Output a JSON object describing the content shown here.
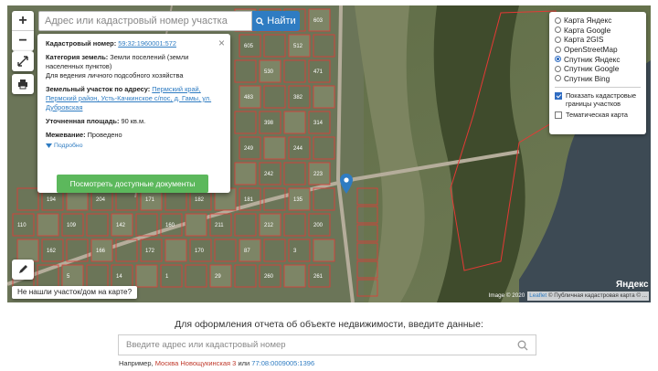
{
  "map": {
    "search_placeholder": "Адрес или кадастровый номер участка",
    "search_button": "Найти",
    "zoom_in": "+",
    "zoom_out": "−",
    "not_found_link": "Не нашли участок/дом на карте?",
    "yandex_logo": "Яндекс",
    "attribution_image": "Image © 2020",
    "attribution_leaflet": "Leaflet",
    "attribution_pkk": "© Публичная кадастровая карта",
    "attribution_rest": "© ...",
    "plot_numbers": [
      "542",
      "603",
      "605",
      "512",
      "530",
      "471",
      "483",
      "382",
      "398",
      "314",
      "249",
      "244",
      "242",
      "223",
      "194",
      "204",
      "171",
      "182",
      "181",
      "135",
      "110",
      "109",
      "142",
      "160",
      "211",
      "212",
      "200",
      "162",
      "166",
      "172",
      "170",
      "87",
      "3",
      "4",
      "5",
      "14",
      "1",
      "29",
      "260",
      "261",
      "991",
      "290",
      "2507",
      "2506",
      "2108",
      "348",
      "377",
      "348",
      "333",
      "341",
      "305",
      "306",
      "281",
      "268"
    ]
  },
  "popup": {
    "cadastral_label": "Кадастровый номер:",
    "cadastral_value": "59:32:1960001:572",
    "category_label": "Категория земель:",
    "category_value": "Земли поселений (земли населенных пунктов)",
    "usage": "Для ведения личного подсобного хозяйства",
    "address_label": "Земельный участок по адресу:",
    "address_value": "Пермский край, Пермский район, Усть-Качкинское с/пос, д. Гамы, ул. Дубровская",
    "area_label": "Уточненная площадь:",
    "area_value": "90 кв.м.",
    "survey_label": "Межевание:",
    "survey_value": "Проведено",
    "more_link": "Подробно",
    "docs_button": "Посмотреть доступные документы",
    "close": "×"
  },
  "layers": {
    "options": [
      {
        "label": "Карта Яндекс",
        "selected": false
      },
      {
        "label": "Карта Google",
        "selected": false
      },
      {
        "label": "Карта 2GIS",
        "selected": false
      },
      {
        "label": "OpenStreetMap",
        "selected": false
      },
      {
        "label": "Спутник Яндекс",
        "selected": true
      },
      {
        "label": "Спутник Google",
        "selected": false
      },
      {
        "label": "Спутник Bing",
        "selected": false
      }
    ],
    "show_borders": "Показать кадастровые границы участков",
    "thematic": "Тематическая карта"
  },
  "form": {
    "caption": "Для оформления отчета об объекте недвижимости, введите данные:",
    "placeholder": "Введите адрес или кадастровый номер",
    "example_label": "Например,",
    "example_address": "Москва Новощукинская 3",
    "example_or": "или",
    "example_cadastral": "77:08:0009005:1396"
  },
  "colors": {
    "accent": "#2f7cc2",
    "docs_button": "#5cb85c",
    "cadastral_border": "#e53935"
  }
}
